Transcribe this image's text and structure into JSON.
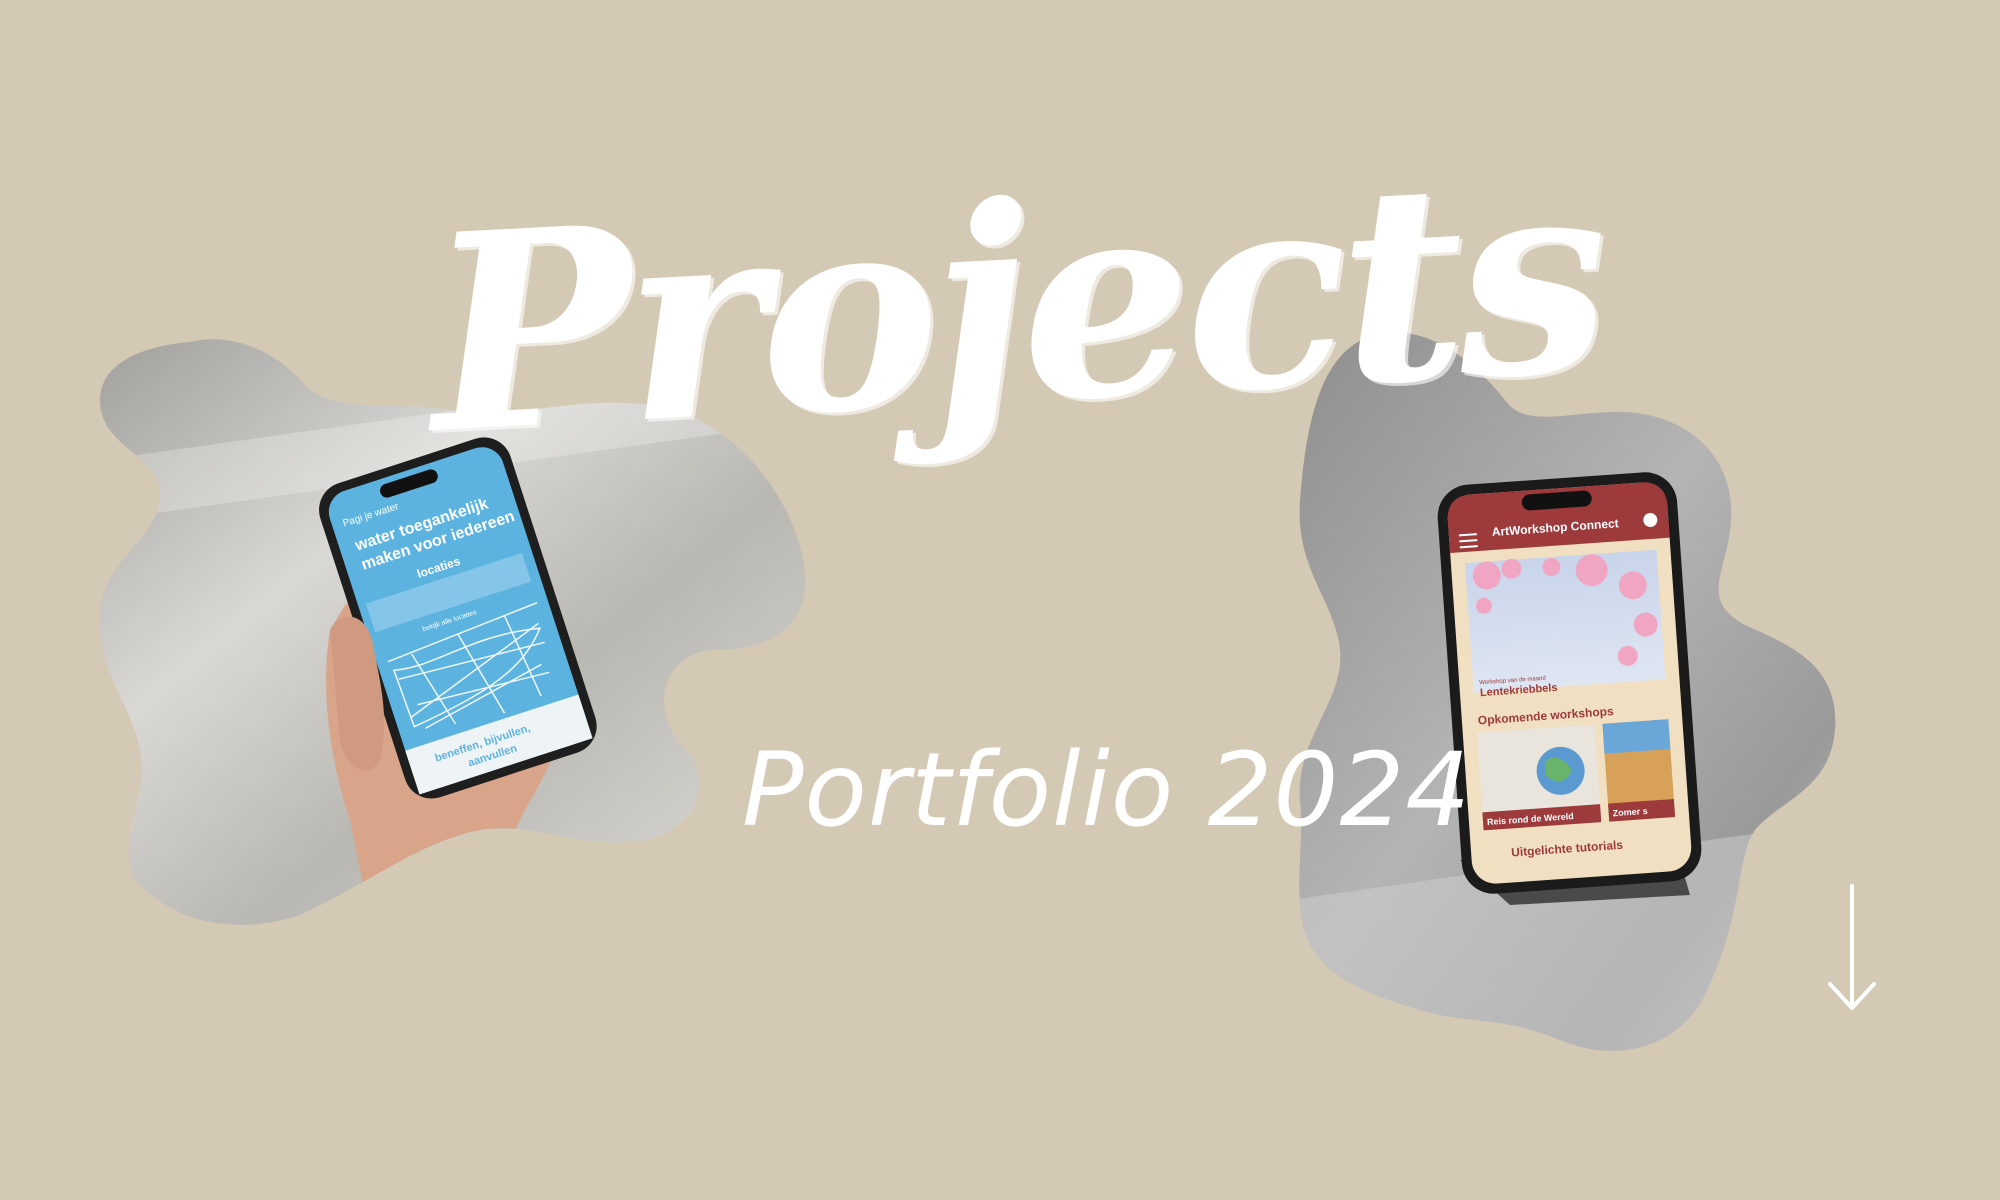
{
  "hero": {
    "title": "Projects",
    "subtitle": "Portfolio 2024"
  },
  "left_phone": {
    "header": "Pagi je water",
    "heading_line1": "water toegankelijk",
    "heading_line2": "maken voor iedereen",
    "section": "locaties",
    "button": "bekijk alle locaties",
    "footer_heading_line1": "beneffen, bijvullen,",
    "footer_heading_line2": "aanvullen"
  },
  "right_phone": {
    "app_title": "ArtWorkshop Connect",
    "card_small": "Workshop van de maand",
    "card_title": "Lentekriebbels",
    "section1": "Opkomende workshops",
    "card2_title": "Reis rond de Wereld",
    "card3_title": "Zomer s",
    "section2": "Uitgelichte tutorials"
  },
  "colors": {
    "background": "#d4c9b4",
    "title": "#ffffff",
    "left_screen": "#5cb3e0",
    "right_header": "#9c3a3c",
    "right_body": "#f1dfc2"
  },
  "icons": {
    "scroll": "arrow-down-icon",
    "menu": "hamburger-menu-icon",
    "palette": "palette-icon"
  }
}
